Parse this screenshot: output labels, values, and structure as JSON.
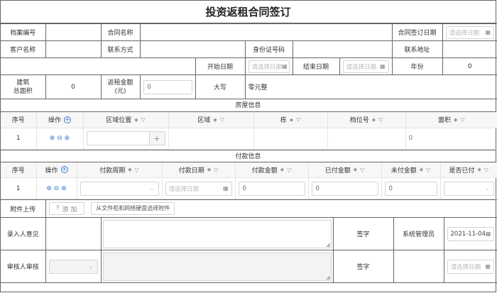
{
  "title": "投资返租合同签订",
  "top": {
    "archive_no": "档案编号",
    "contract_name": "合同名称",
    "sign_date": "合同签订日期",
    "customer_name": "客户名称",
    "contact": "联系方式",
    "id_no": "身份证号码",
    "address": "联系地址",
    "start_date": "开始日期",
    "end_date": "结束日期",
    "years": "年份",
    "years_value": "0",
    "building_area_line1": "建筑",
    "building_area_line2": "总面积",
    "building_area_value": "0",
    "rent_amount_line1": "返租金额",
    "rent_amount_line2": "(元)",
    "rent_amount_value": "0",
    "daxie": "大写",
    "daxie_value": "零元整",
    "date_placeholder": "请选择日期"
  },
  "house": {
    "section": "房屋信息",
    "columns": [
      "序号",
      "操作",
      "区域位置",
      "区域",
      "栋",
      "档位号",
      "面积"
    ],
    "row": {
      "index": "1",
      "area_value": "0",
      "add": "+"
    }
  },
  "payment": {
    "section": "付款信息",
    "columns": [
      "序号",
      "操作",
      "付款周期",
      "付款日期",
      "付款金额",
      "已付金额",
      "未付金额",
      "是否已付"
    ],
    "row": {
      "index": "1",
      "date_placeholder": "请选择日期",
      "amount": "0",
      "paid": "0",
      "unpaid": "0"
    }
  },
  "attachment": {
    "label": "附件上传",
    "add": "添 加",
    "select_btn": "从文件柜和网络硬盘选择附件"
  },
  "opinion": {
    "label": "录入人意见",
    "sign": "签字",
    "signer": "系统管理员",
    "date": "2021-11-04"
  },
  "review": {
    "label": "审核人审核",
    "sign": "签字",
    "date_placeholder": "请选择日期"
  }
}
